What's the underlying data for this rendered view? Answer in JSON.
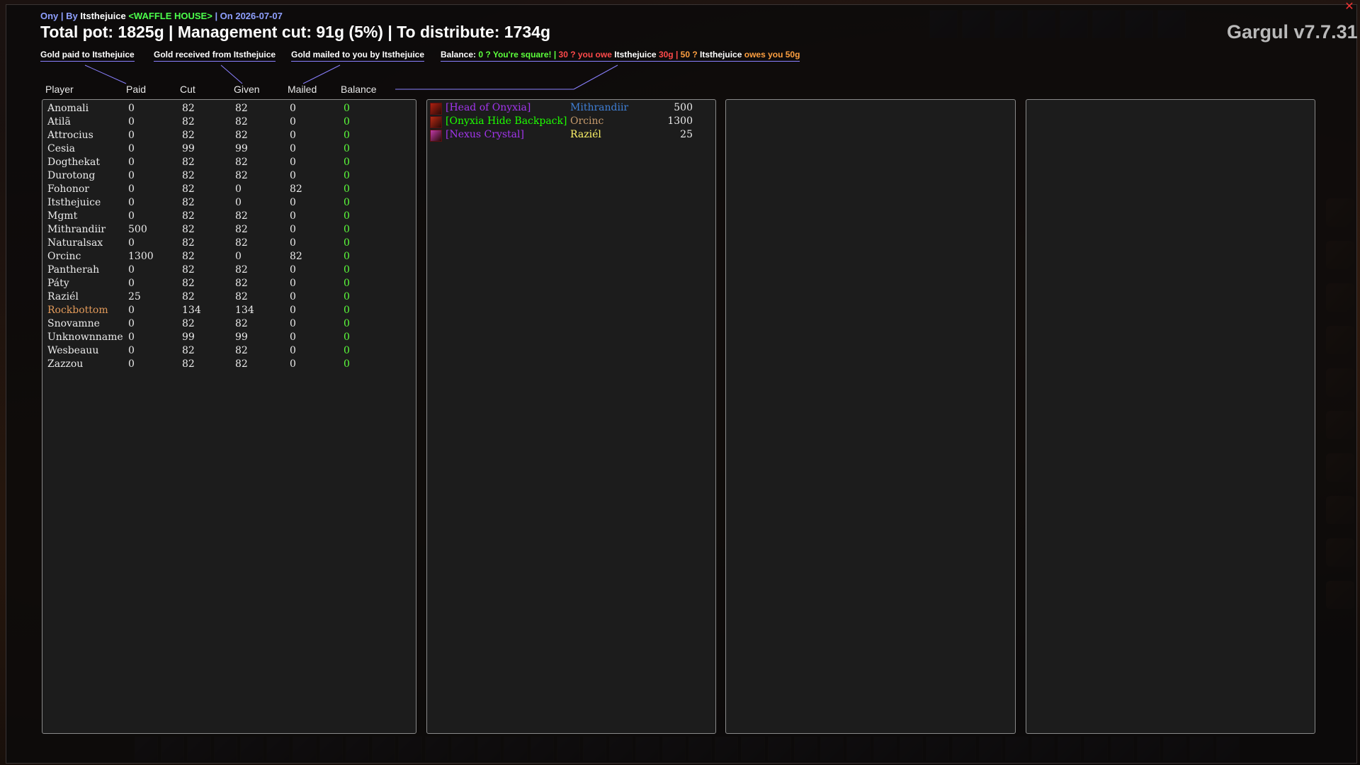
{
  "header": {
    "raid": "Ony",
    "by_prefix": "| By",
    "organizer": "Itsthejuice",
    "guild": "<WAFFLE HOUSE>",
    "date_text": "| On 2026-07-07",
    "summary": "Total pot: 1825g | Management cut: 91g (5%) | To distribute: 1734g",
    "version": "Gargul v7.7.31"
  },
  "legend": {
    "paid_to": "Gold paid to Itsthejuice",
    "received_from": "Gold received from Itsthejuice",
    "mailed_by": "Gold mailed to you by Itsthejuice",
    "balance_label": "Balance:",
    "square_text": "0 ? You're square!",
    "sep1": "|",
    "owe_text": "30 ? you owe",
    "owe_name": "Itsthejuice",
    "owe_amount": "30g",
    "sep2": "|",
    "owes_text": "50 ?",
    "owes_name": "Itsthejuice",
    "owes_suffix": "owes you 50g"
  },
  "columns": {
    "player": "Player",
    "paid": "Paid",
    "cut": "Cut",
    "given": "Given",
    "mailed": "Mailed",
    "balance": "Balance"
  },
  "players": [
    {
      "name": "Anomali",
      "paid": "0",
      "cut": "82",
      "given": "82",
      "mailed": "0",
      "balance": "0"
    },
    {
      "name": "Atilã",
      "paid": "0",
      "cut": "82",
      "given": "82",
      "mailed": "0",
      "balance": "0"
    },
    {
      "name": "Attrocius",
      "paid": "0",
      "cut": "82",
      "given": "82",
      "mailed": "0",
      "balance": "0"
    },
    {
      "name": "Cesia",
      "paid": "0",
      "cut": "99",
      "given": "99",
      "mailed": "0",
      "balance": "0"
    },
    {
      "name": "Dogthekat",
      "paid": "0",
      "cut": "82",
      "given": "82",
      "mailed": "0",
      "balance": "0"
    },
    {
      "name": "Durotong",
      "paid": "0",
      "cut": "82",
      "given": "82",
      "mailed": "0",
      "balance": "0"
    },
    {
      "name": "Fohonor",
      "paid": "0",
      "cut": "82",
      "given": "0",
      "mailed": "82",
      "balance": "0"
    },
    {
      "name": "Itsthejuice",
      "paid": "0",
      "cut": "82",
      "given": "0",
      "mailed": "0",
      "balance": "0"
    },
    {
      "name": "Mgmt",
      "paid": "0",
      "cut": "82",
      "given": "82",
      "mailed": "0",
      "balance": "0"
    },
    {
      "name": "Mithrandiir",
      "paid": "500",
      "cut": "82",
      "given": "82",
      "mailed": "0",
      "balance": "0"
    },
    {
      "name": "Naturalsax",
      "paid": "0",
      "cut": "82",
      "given": "82",
      "mailed": "0",
      "balance": "0"
    },
    {
      "name": "Orcinc",
      "paid": "1300",
      "cut": "82",
      "given": "0",
      "mailed": "82",
      "balance": "0"
    },
    {
      "name": "Pantherah",
      "paid": "0",
      "cut": "82",
      "given": "82",
      "mailed": "0",
      "balance": "0"
    },
    {
      "name": "Páty",
      "paid": "0",
      "cut": "82",
      "given": "82",
      "mailed": "0",
      "balance": "0"
    },
    {
      "name": "Raziél",
      "paid": "25",
      "cut": "82",
      "given": "82",
      "mailed": "0",
      "balance": "0"
    },
    {
      "name": "Rockbottom",
      "paid": "0",
      "cut": "134",
      "given": "134",
      "mailed": "0",
      "balance": "0"
    },
    {
      "name": "Snovamne",
      "paid": "0",
      "cut": "82",
      "given": "82",
      "mailed": "0",
      "balance": "0"
    },
    {
      "name": "Unknownname",
      "paid": "0",
      "cut": "99",
      "given": "99",
      "mailed": "0",
      "balance": "0"
    },
    {
      "name": "Wesbeauu",
      "paid": "0",
      "cut": "82",
      "given": "82",
      "mailed": "0",
      "balance": "0"
    },
    {
      "name": "Zazzou",
      "paid": "0",
      "cut": "82",
      "given": "82",
      "mailed": "0",
      "balance": "0"
    }
  ],
  "loot": [
    {
      "item": "[Head of Onyxia]",
      "winner": "Mithrandiir",
      "price": "500",
      "item_color": "#a335ee",
      "winner_color": "#3f7fd6",
      "icon": "head-of-onyxia-icon",
      "icon_color": "#b02010"
    },
    {
      "item": "[Onyxia Hide Backpack]",
      "winner": "Orcinc",
      "price": "1300",
      "item_color": "#1eff00",
      "winner_color": "#c69b6d",
      "icon": "backpack-icon",
      "icon_color": "#b82a14"
    },
    {
      "item": "[Nexus Crystal]",
      "winner": "Raziél",
      "price": "25",
      "item_color": "#a335ee",
      "winner_color": "#fff569",
      "icon": "crystal-icon",
      "icon_color": "#c03aa8"
    }
  ],
  "colors": {
    "header_blue": "#8fa0ff",
    "guild_green": "#4cff4c",
    "balance_green": "#5cff3c",
    "accent_line": "#8a80ff",
    "highlight_player": "#e29a5a",
    "close_red": "#ee3333"
  }
}
